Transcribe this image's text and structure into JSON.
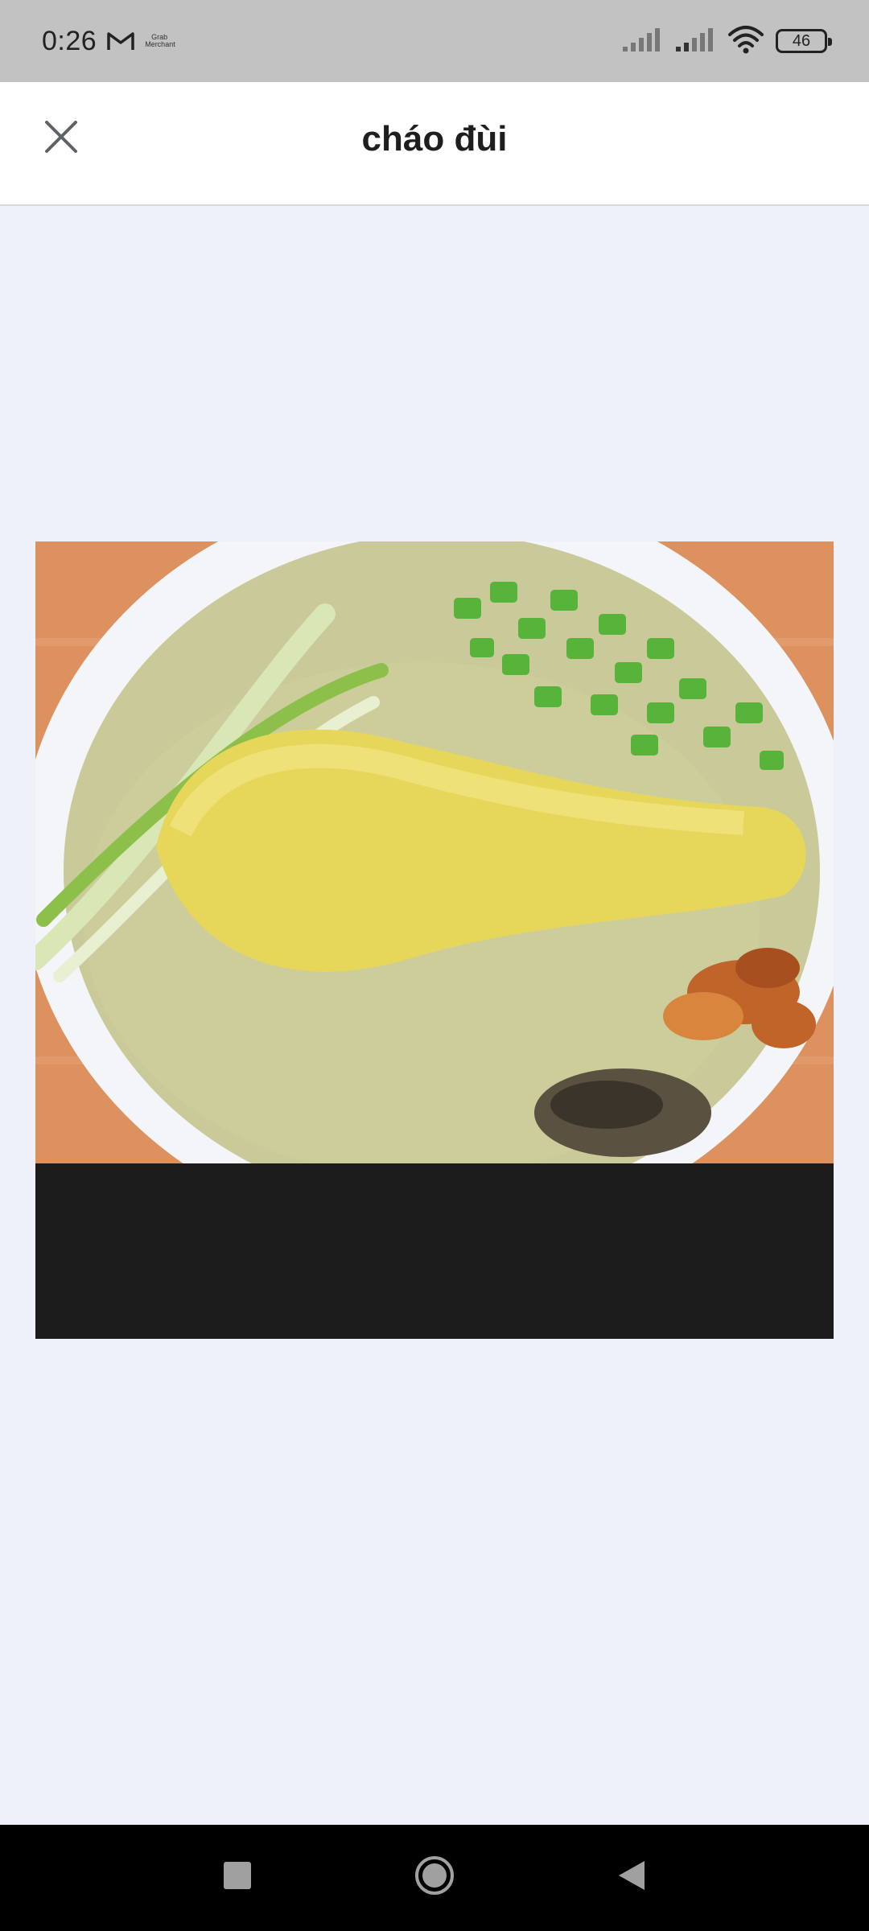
{
  "status_bar": {
    "time": "0:26",
    "tiny_label": "Grab Merchant",
    "battery": "46"
  },
  "header": {
    "title": "cháo đùi"
  },
  "icons": {
    "close": "close-icon",
    "mail": "gmail-icon",
    "signal": "signal-icon",
    "wifi": "wifi-icon",
    "battery": "battery-icon",
    "recents": "square-icon",
    "home": "home-circle-icon",
    "back": "back-triangle-icon"
  },
  "colors": {
    "status_bar": "#c2c2c2",
    "header": "#ffffff",
    "background": "#eef1fa",
    "image_letterbox": "#1c1c1c",
    "nav_bar": "#000000"
  }
}
